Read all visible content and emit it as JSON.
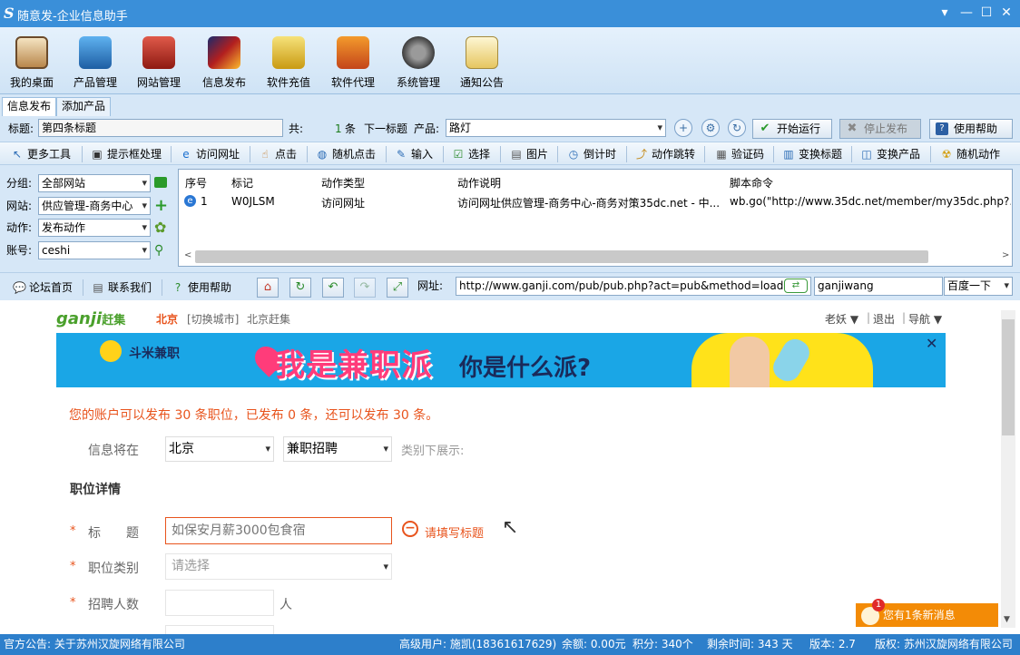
{
  "window": {
    "logo": "S",
    "title": "随意发-企业信息助手",
    "controls": [
      "▾",
      "—",
      "☐",
      "✕"
    ]
  },
  "toolbar": {
    "items": [
      {
        "label": "我的桌面",
        "icon": "house-icon"
      },
      {
        "label": "产品管理",
        "icon": "hard-drive-icon"
      },
      {
        "label": "网站管理",
        "icon": "red-building-icon"
      },
      {
        "label": "信息发布",
        "icon": "magic-wand-icon"
      },
      {
        "label": "软件充值",
        "icon": "coin-stack-icon"
      },
      {
        "label": "软件代理",
        "icon": "gift-box-icon"
      },
      {
        "label": "系统管理",
        "icon": "gear-icon"
      },
      {
        "label": "通知公告",
        "icon": "notepad-icon"
      }
    ]
  },
  "tabs": [
    "信息发布",
    "添加产品"
  ],
  "title_row": {
    "title_label": "标题:",
    "title_value": "第四条标题",
    "total_label": "共:",
    "count": "1",
    "count_unit": "条",
    "next_label": "下一标题",
    "product_label": "产品:",
    "product_value": "路灯",
    "start_button": "开始运行",
    "stop_button": "停止发布",
    "help_button": "使用帮助"
  },
  "actions": [
    "更多工具",
    "提示框处理",
    "访问网址",
    "点击",
    "随机点击",
    "输入",
    "选择",
    "图片",
    "倒计时",
    "动作跳转",
    "验证码",
    "变换标题",
    "变换产品",
    "随机动作"
  ],
  "left_panel": [
    {
      "label": "分组:",
      "value": "全部网站"
    },
    {
      "label": "网站:",
      "value": "供应管理-商务中心"
    },
    {
      "label": "动作:",
      "value": "发布动作"
    },
    {
      "label": "账号:",
      "value": "ceshi"
    }
  ],
  "grid": {
    "headers": [
      "序号",
      "标记",
      "动作类型",
      "动作说明",
      "脚本命令"
    ],
    "rows": [
      {
        "index": "1",
        "mark": "W0JLSM",
        "type": "访问网址",
        "desc": "访问网址供应管理-商务中心-商务对策35dc.net - 中...",
        "script": "wb.go(\"http://www.35dc.net/member/my35dc.php?..."
      }
    ]
  },
  "browser_bar": {
    "links": [
      "论坛首页",
      "联系我们",
      "使用帮助"
    ],
    "url_label": "网址:",
    "url": "http://www.ganji.com/pub/pub.php?act=pub&method=load&ci",
    "site": "ganjiwang",
    "engine": "百度一下"
  },
  "webpage": {
    "logo": "ganji",
    "logo_cn": "赶集",
    "city": "北京",
    "switch_city": "[切换城市]",
    "city_site": "北京赶集",
    "user": "老妖 ▼",
    "logout": "退出",
    "nav": "导航 ▼",
    "banner_brand": "斗米兼职",
    "banner_text": "我是兼职派",
    "banner_text2": "你是什么派?",
    "notice": "您的账户可以发布 30 条职位，已发布 0 条，还可以发布 30 条。",
    "category_label": "信息将在",
    "city_select": "北京",
    "category_select": "兼职招聘",
    "category_suffix": "类别下展示:",
    "section_title": "职位详情",
    "fields": [
      {
        "label": "标　　题",
        "placeholder": "如保安月薪3000包食宿",
        "error": "请填写标题"
      },
      {
        "label": "职位类别",
        "placeholder": "请选择"
      },
      {
        "label": "招聘人数",
        "unit": "人"
      }
    ]
  },
  "toast": {
    "badge": "1",
    "text": "您有1条新消息"
  },
  "status": {
    "notice": "官方公告: 关于苏州汉旋网络有限公司",
    "user": "高级用户: 施凯(18361617629)",
    "balance": "余额: 0.00元",
    "points": "积分: 340个",
    "remaining": "剩余时间: 343 天",
    "version": "版本: 2.7",
    "copyright": "版权: 苏州汉旋网络有限公司"
  },
  "colors": {
    "titlebar": "#3a8fd9",
    "status": "#2d7fcb",
    "accent_orange": "#e8541d",
    "toast": "#f38b06"
  }
}
